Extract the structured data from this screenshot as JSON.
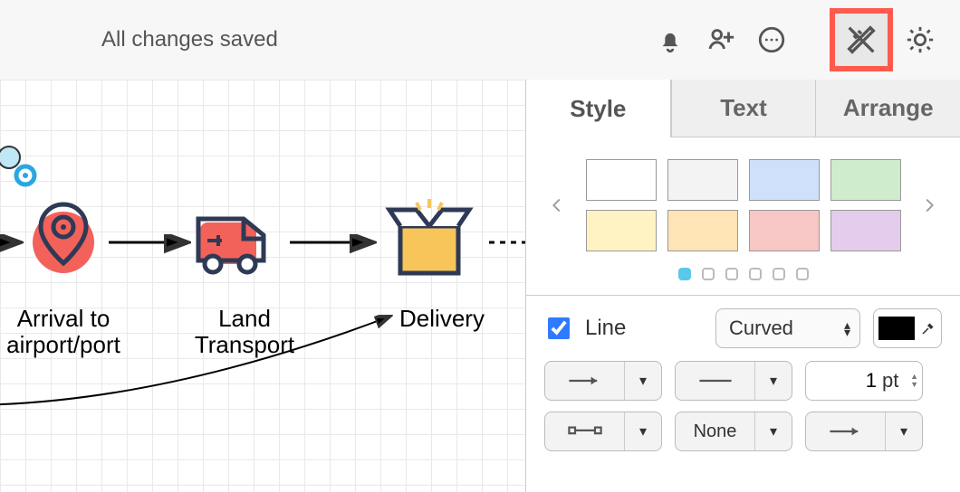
{
  "toolbar": {
    "status": "All changes saved"
  },
  "canvas": {
    "nodes": [
      {
        "id": "arrival",
        "label": "Arrival to\nairport/port"
      },
      {
        "id": "land",
        "label": "Land\nTransport"
      },
      {
        "id": "delivery",
        "label": "Delivery"
      }
    ]
  },
  "panel": {
    "tabs": [
      "Style",
      "Text",
      "Arrange"
    ],
    "active_tab": 0,
    "swatches": [
      "#ffffff",
      "#f3f3f3",
      "#cfe0fb",
      "#cfeccd",
      "#fff3c4",
      "#ffe4b5",
      "#f6c7c4",
      "#e4cdec"
    ],
    "pager_count": 6,
    "pager_active": 0,
    "line": {
      "checkbox_label": "Line",
      "checked": true,
      "style": "Curved",
      "color": "#000000",
      "width_value": "1",
      "width_unit": "pt",
      "waypoint": "None"
    }
  }
}
